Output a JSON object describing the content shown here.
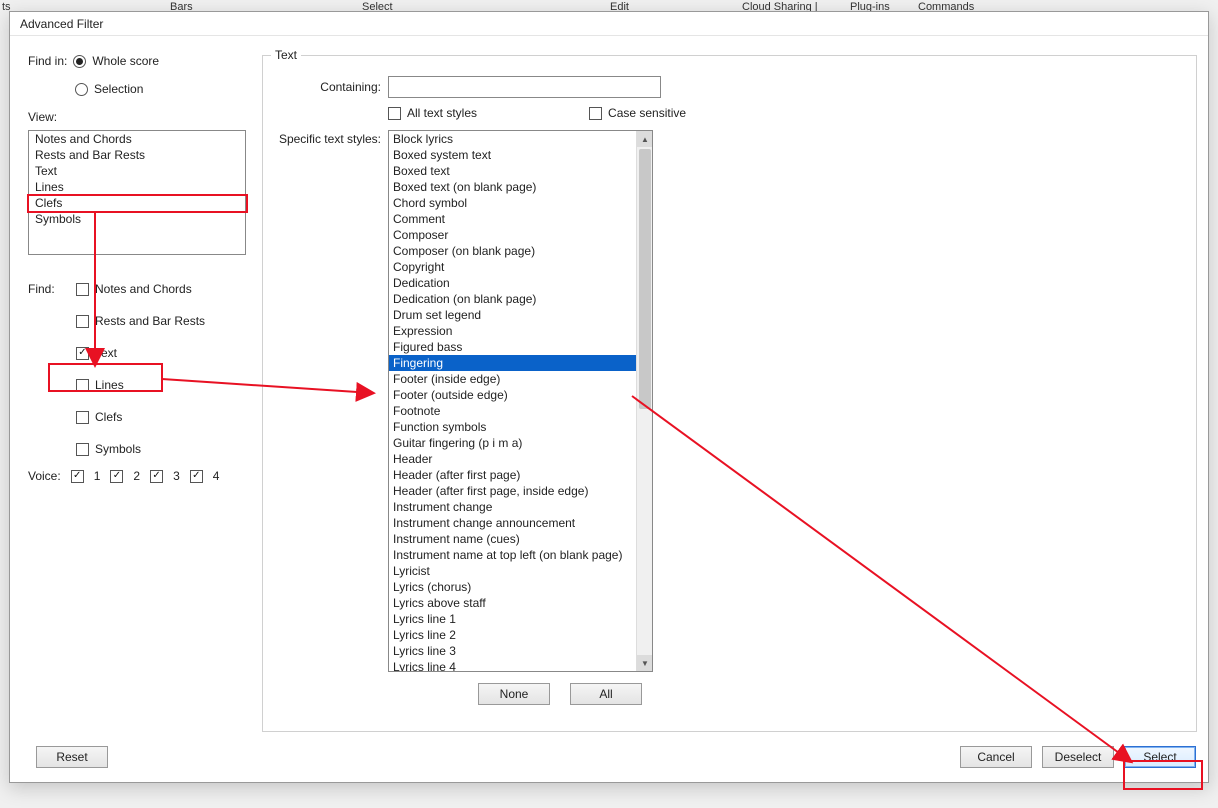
{
  "bg_menu": {
    "bars": "Bars",
    "select": "Select",
    "edit": "Edit",
    "cloud": "Cloud Sharing |",
    "plugins": "Plug-ins",
    "commands": "Commands",
    "ts": "ts"
  },
  "dialog_title": "Advanced Filter",
  "find_in_label": "Find in:",
  "find_in_whole": "Whole score",
  "find_in_selection": "Selection",
  "view_label": "View:",
  "view_items": [
    "Notes and Chords",
    "Rests and Bar Rests",
    "Text",
    "Lines",
    "Clefs",
    "Symbols"
  ],
  "find_label": "Find:",
  "find_items": [
    {
      "label": "Notes and Chords",
      "checked": false
    },
    {
      "label": "Rests and Bar Rests",
      "checked": false
    },
    {
      "label": "Text",
      "checked": true
    },
    {
      "label": "Lines",
      "checked": false
    },
    {
      "label": "Clefs",
      "checked": false
    },
    {
      "label": "Symbols",
      "checked": false
    }
  ],
  "voice_label": "Voice:",
  "voices": [
    {
      "n": "1",
      "checked": true
    },
    {
      "n": "2",
      "checked": true
    },
    {
      "n": "3",
      "checked": true
    },
    {
      "n": "4",
      "checked": true
    }
  ],
  "text_group": {
    "legend": "Text",
    "containing_label": "Containing:",
    "containing_value": "",
    "all_styles_label": "All text styles",
    "all_styles_checked": false,
    "case_label": "Case sensitive",
    "case_checked": false,
    "specific_label": "Specific text styles:",
    "none_btn": "None",
    "all_btn": "All",
    "selected_index": 14,
    "styles": [
      "Block lyrics",
      "Boxed system text",
      "Boxed text",
      "Boxed text (on blank page)",
      "Chord symbol",
      "Comment",
      "Composer",
      "Composer (on blank page)",
      "Copyright",
      "Dedication",
      "Dedication (on blank page)",
      "Drum set legend",
      "Expression",
      "Figured bass",
      "Fingering",
      "Footer (inside edge)",
      "Footer (outside edge)",
      "Footnote",
      "Function symbols",
      "Guitar fingering (p i m a)",
      "Header",
      "Header (after first page)",
      "Header (after first page, inside edge)",
      "Instrument change",
      "Instrument change announcement",
      "Instrument name (cues)",
      "Instrument name at top left (on blank page)",
      "Lyricist",
      "Lyrics (chorus)",
      "Lyrics above staff",
      "Lyrics line 1",
      "Lyrics line 2",
      "Lyrics line 3",
      "Lyrics line 4"
    ]
  },
  "buttons": {
    "reset": "Reset",
    "cancel": "Cancel",
    "deselect": "Deselect",
    "select": "Select"
  }
}
